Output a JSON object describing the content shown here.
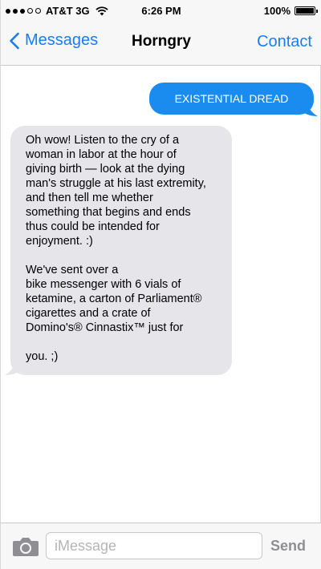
{
  "status_bar": {
    "carrier": "AT&T 3G",
    "time": "6:26 PM",
    "battery": "100%",
    "battery_level": 1.0,
    "signal_bars_filled": 3,
    "signal_bars_total": 5
  },
  "nav": {
    "back_label": "Messages",
    "title": "Horngry",
    "contact_label": "Contact"
  },
  "messages": [
    {
      "direction": "outgoing",
      "text": "EXISTENTIAL DREAD"
    },
    {
      "direction": "incoming",
      "text": "Oh wow! Listen to the cry of a\nwoman in labor at the hour of\ngiving birth — look at the dying\nman's struggle at his last extremity,\nand then tell me whether\nsomething that begins and ends\nthus could be intended for\nenjoyment. :)\n\nWe've sent over a\nbike messenger with 6 vials of\nketamine, a carton of Parliament®\ncigarettes and a crate of\nDomino's® Cinnastix™ just for\n\nyou. ;)"
    }
  ],
  "input": {
    "placeholder": "iMessage",
    "send_label": "Send"
  },
  "colors": {
    "accent": "#1a7cf5",
    "outgoing_bubble": "#1a8cf0",
    "incoming_bubble": "#e5e5ea"
  },
  "icons": {
    "back": "chevron-left-icon",
    "camera": "camera-icon",
    "wifi": "wifi-icon",
    "battery": "battery-icon"
  }
}
